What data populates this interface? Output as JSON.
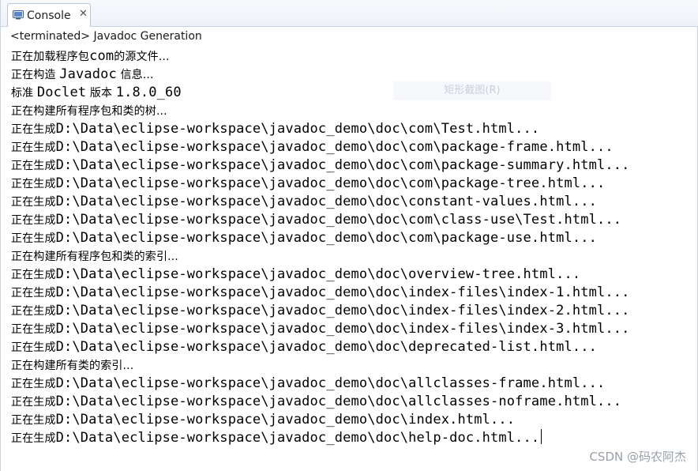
{
  "tab": {
    "label": "Console",
    "icon": "console-icon",
    "close_glyph": "✕"
  },
  "status": "<terminated> Javadoc Generation",
  "console_lines": [
    {
      "cn": "正在加载程序包",
      "mono": "com",
      "cn2": "的源文件..."
    },
    {
      "cn": "正在构造 ",
      "mono": "Javadoc",
      "cn2": " 信息..."
    },
    {
      "cn": "标准 ",
      "mono": "Doclet",
      "cn2": " 版本 ",
      "mono2": "1.8.0_60"
    },
    {
      "cn": "正在构建所有程序包和类的树..."
    },
    {
      "cn": "正在生成",
      "mono": "D:\\Data\\eclipse-workspace\\javadoc_demo\\doc\\com\\Test.html..."
    },
    {
      "cn": "正在生成",
      "mono": "D:\\Data\\eclipse-workspace\\javadoc_demo\\doc\\com\\package-frame.html..."
    },
    {
      "cn": "正在生成",
      "mono": "D:\\Data\\eclipse-workspace\\javadoc_demo\\doc\\com\\package-summary.html..."
    },
    {
      "cn": "正在生成",
      "mono": "D:\\Data\\eclipse-workspace\\javadoc_demo\\doc\\com\\package-tree.html..."
    },
    {
      "cn": "正在生成",
      "mono": "D:\\Data\\eclipse-workspace\\javadoc_demo\\doc\\constant-values.html..."
    },
    {
      "cn": "正在生成",
      "mono": "D:\\Data\\eclipse-workspace\\javadoc_demo\\doc\\com\\class-use\\Test.html..."
    },
    {
      "cn": "正在生成",
      "mono": "D:\\Data\\eclipse-workspace\\javadoc_demo\\doc\\com\\package-use.html..."
    },
    {
      "cn": "正在构建所有程序包和类的索引..."
    },
    {
      "cn": "正在生成",
      "mono": "D:\\Data\\eclipse-workspace\\javadoc_demo\\doc\\overview-tree.html..."
    },
    {
      "cn": "正在生成",
      "mono": "D:\\Data\\eclipse-workspace\\javadoc_demo\\doc\\index-files\\index-1.html..."
    },
    {
      "cn": "正在生成",
      "mono": "D:\\Data\\eclipse-workspace\\javadoc_demo\\doc\\index-files\\index-2.html..."
    },
    {
      "cn": "正在生成",
      "mono": "D:\\Data\\eclipse-workspace\\javadoc_demo\\doc\\index-files\\index-3.html..."
    },
    {
      "cn": "正在生成",
      "mono": "D:\\Data\\eclipse-workspace\\javadoc_demo\\doc\\deprecated-list.html..."
    },
    {
      "cn": "正在构建所有类的索引..."
    },
    {
      "cn": "正在生成",
      "mono": "D:\\Data\\eclipse-workspace\\javadoc_demo\\doc\\allclasses-frame.html..."
    },
    {
      "cn": "正在生成",
      "mono": "D:\\Data\\eclipse-workspace\\javadoc_demo\\doc\\allclasses-noframe.html..."
    },
    {
      "cn": "正在生成",
      "mono": "D:\\Data\\eclipse-workspace\\javadoc_demo\\doc\\index.html..."
    },
    {
      "cn": "正在生成",
      "mono": "D:\\Data\\eclipse-workspace\\javadoc_demo\\doc\\help-doc.html...",
      "caret": true
    }
  ],
  "overlay": {
    "ghost_text": "矩形截图(R)"
  },
  "watermark": "CSDN @码农阿杰",
  "colors": {
    "text": "#000000",
    "tab_border": "#b9c6da",
    "watermark": "#9aa0a8"
  }
}
